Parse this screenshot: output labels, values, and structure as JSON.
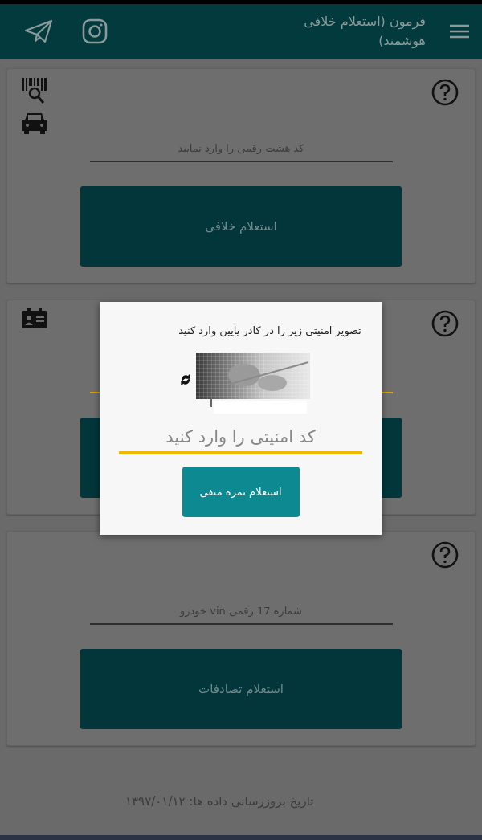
{
  "header": {
    "title": "فرمون (استعلام خلافی هوشمند)"
  },
  "cards": [
    {
      "kind": "plate",
      "field": {
        "placeholder": "کد هشت رقمی را وارد نمایید",
        "focused": false
      },
      "button": "استعلام خلافی"
    },
    {
      "kind": "license",
      "field": {
        "focused": true
      }
    },
    {
      "kind": "vin",
      "field": {
        "placeholder": "شماره 17 رقمی vin خودرو",
        "focused": false
      },
      "button": "استعلام تصادفات"
    }
  ],
  "dialog": {
    "message": "تصویر امنیتی زیر را در کادر پایین وارد کنید",
    "input": {
      "placeholder": "کد امنیتی را وارد کنید",
      "focused": true
    },
    "button": "استعلام نمره منفی"
  },
  "footer": {
    "updated": "تاریخ بروزرسانی داده ها:  ۱۳۹۷/۰۱/۱۲"
  }
}
